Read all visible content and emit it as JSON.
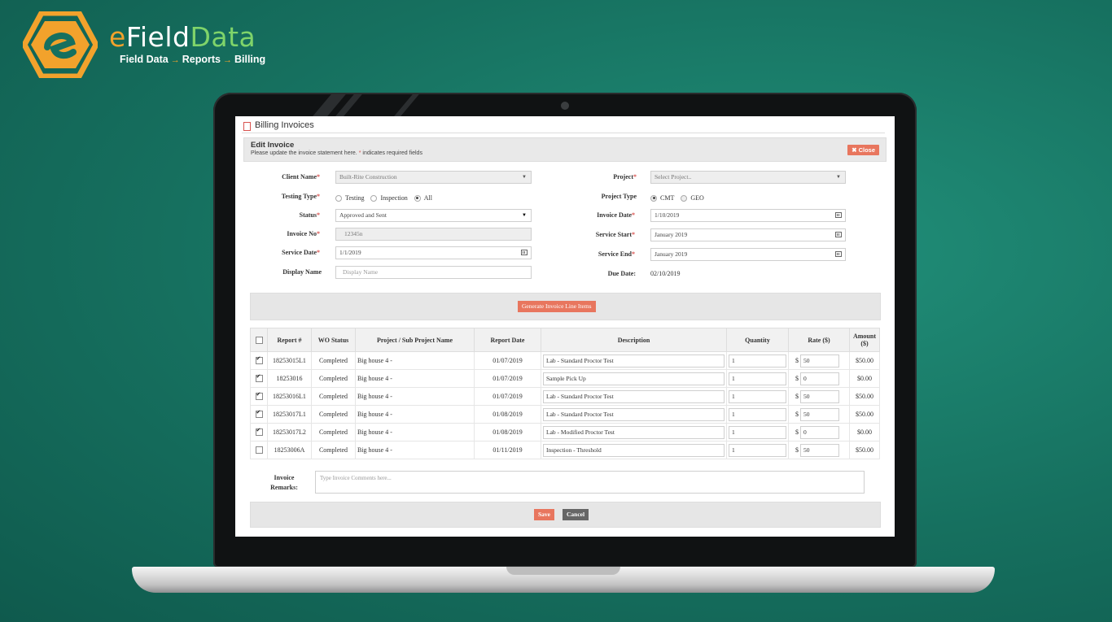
{
  "brand": {
    "name_part1": "e",
    "name_part2": "Field",
    "name_part3": "Data",
    "tagline_1": "Field Data",
    "tagline_2": "Reports",
    "tagline_3": "Billing",
    "arrow": "→",
    "colors": {
      "orange": "#f2a22c",
      "green": "#7fd46a",
      "background": "#16705f"
    }
  },
  "window": {
    "title": "Billing Invoices",
    "icon": "document-icon"
  },
  "edit": {
    "heading": "Edit Invoice",
    "subtext_before": "Please update the invoice statement here.",
    "required_marker": "*",
    "subtext_after": "indicates required fields",
    "close_label": "✖ Close"
  },
  "form": {
    "client_name": {
      "label": "Client Name",
      "value": "Built-Rite Construction"
    },
    "testing_type": {
      "label": "Testing Type",
      "options": [
        "Testing",
        "Inspection",
        "All"
      ],
      "selected": "All"
    },
    "status": {
      "label": "Status",
      "value": "Approved and Sent"
    },
    "invoice_no": {
      "label": "Invoice No",
      "value": "12345n"
    },
    "service_date": {
      "label": "Service Date",
      "value": "1/1/2019"
    },
    "display_name": {
      "label": "Display Name",
      "placeholder": "Display Name"
    },
    "project": {
      "label": "Project",
      "placeholder": "Select Project.."
    },
    "project_type": {
      "label": "Project Type",
      "options": [
        "CMT",
        "GEO"
      ],
      "selected": "CMT"
    },
    "invoice_date": {
      "label": "Invoice Date",
      "value": "1/10/2019"
    },
    "service_start": {
      "label": "Service Start",
      "value": "January 2019"
    },
    "service_end": {
      "label": "Service End",
      "value": "January 2019"
    },
    "due_date": {
      "label": "Due Date:",
      "value": "02/10/2019"
    },
    "required_marker": "*"
  },
  "generate_label": "Generate Invoice Line Items",
  "table": {
    "headers": [
      "Report #",
      "WO Status",
      "Project / Sub Project Name",
      "Report Date",
      "Description",
      "Quantity",
      "Rate ($)",
      "Amount ($)"
    ],
    "currency": "$",
    "rows": [
      {
        "checked": true,
        "report": "18253015L1",
        "status": "Completed",
        "project": "Big house 4 -",
        "date": "01/07/2019",
        "description": "Lab - Standard Proctor Test",
        "quantity": "1",
        "rate": "50",
        "amount": "$50.00"
      },
      {
        "checked": true,
        "report": "18253016",
        "status": "Completed",
        "project": "Big house 4 -",
        "date": "01/07/2019",
        "description": "Sample Pick Up",
        "quantity": "1",
        "rate": "0",
        "amount": "$0.00"
      },
      {
        "checked": true,
        "report": "18253016L1",
        "status": "Completed",
        "project": "Big house 4 -",
        "date": "01/07/2019",
        "description": "Lab - Standard Proctor Test",
        "quantity": "1",
        "rate": "50",
        "amount": "$50.00"
      },
      {
        "checked": true,
        "report": "18253017L1",
        "status": "Completed",
        "project": "Big house 4 -",
        "date": "01/08/2019",
        "description": "Lab - Standard Proctor Test",
        "quantity": "1",
        "rate": "50",
        "amount": "$50.00"
      },
      {
        "checked": true,
        "report": "18253017L2",
        "status": "Completed",
        "project": "Big house 4 -",
        "date": "01/08/2019",
        "description": "Lab - Modified Proctor Test",
        "quantity": "1",
        "rate": "0",
        "amount": "$0.00"
      },
      {
        "checked": false,
        "report": "18253006A",
        "status": "Completed",
        "project": "Big house 4 -",
        "date": "01/11/2019",
        "description": "Inspection - Threshold",
        "quantity": "1",
        "rate": "50",
        "amount": "$50.00"
      }
    ]
  },
  "remarks": {
    "label_1": "Invoice",
    "label_2": "Remarks:",
    "placeholder": "Type Invoice Comments here..."
  },
  "buttons": {
    "save": "Save",
    "cancel": "Cancel"
  }
}
